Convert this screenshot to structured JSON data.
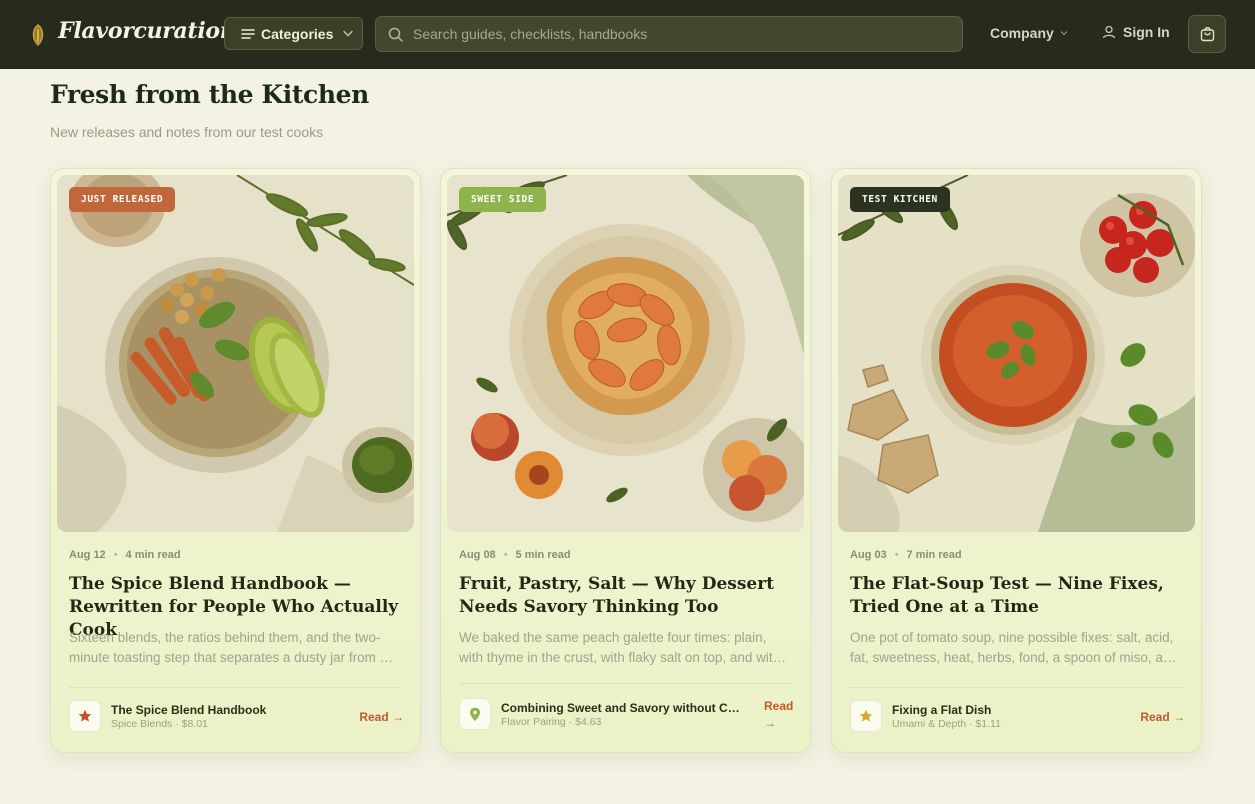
{
  "header": {
    "brand": "Flavorcuration",
    "categories_label": "Categories",
    "search_placeholder": "Search guides, checklists, handbooks",
    "company_label": "Company",
    "signin_label": "Sign In"
  },
  "section": {
    "title": "Fresh from the Kitchen",
    "subtitle": "New releases and notes from our test cooks"
  },
  "cards": [
    {
      "badge": "JUST RELEASED",
      "badge_color": "#c0683c",
      "date": "Aug 12",
      "read_time": "4 min read",
      "title": "The Spice Blend Handbook — Rewritten for People Who Actually Cook",
      "excerpt": "Sixteen blends, the ratios behind them, and the two-minute toasting step that separates a dusty jar from a blend you'll reach for daily.",
      "product_name": "The Spice Blend Handbook",
      "product_meta": "Spice Blends · $8.01",
      "product_icon": "star-icon",
      "read_label": "Read →"
    },
    {
      "badge": "SWEET SIDE",
      "badge_color": "#8fb34d",
      "date": "Aug 08",
      "read_time": "5 min read",
      "title": "Fruit, Pastry, Salt — Why Dessert Needs Savory Thinking Too",
      "excerpt": "We baked the same peach galette four times: plain, with thyme in the crust, with flaky salt on top, and with a drizzle of balsamic.",
      "product_name": "Combining Sweet and Savory without Clashing",
      "product_meta": "Flavor Pairing · $4.63",
      "product_icon": "map-pin-icon",
      "read_label": "Read →"
    },
    {
      "badge": "TEST KITCHEN",
      "badge_color": "#2b3320",
      "date": "Aug 03",
      "read_time": "7 min read",
      "title": "The Flat-Soup Test — Nine Fixes, Tried One at a Time",
      "excerpt": "One pot of tomato soup, nine possible fixes: salt, acid, fat, sweetness, heat, herbs, fond, a spoon of miso, and time.",
      "product_name": "Fixing a Flat Dish",
      "product_meta": "Umami & Depth · $1.11",
      "product_icon": "star-icon",
      "read_label": "Read →"
    }
  ]
}
